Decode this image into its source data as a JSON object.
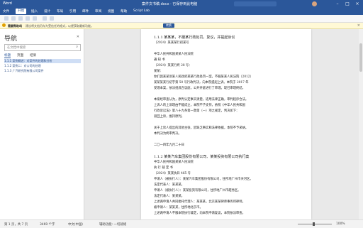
{
  "window": {
    "app_name": "Word",
    "title": "案件文书稿.docx · 已保存到此电脑",
    "minimize": "–",
    "maximize": "□",
    "close": "×"
  },
  "menu": [
    "文件",
    "开始",
    "插入",
    "设计",
    "布局",
    "引用",
    "邮件",
    "审阅",
    "视图",
    "帮助",
    "Script Lab"
  ],
  "menu_active_index": 1,
  "notice": {
    "label": "需要帮助吗",
    "message": "建议将文档另存为受信任的格式，以便获取最新功能。",
    "button": "转换",
    "close": "×"
  },
  "nav": {
    "title": "导航",
    "search_placeholder": "在文档中搜索",
    "tabs": [
      "标题",
      "页面",
      "结果"
    ],
    "items": [
      "1.1.1 案例概述：对案件的处理和分析",
      "1.1.2 案例二：对公司的处理",
      "1.1.3 广汽研究院有限公司案件"
    ],
    "selected_index": 0
  },
  "document": {
    "lines": [
      "1.1.1 某某某，不服某行政处罚，复议，并提起诉讼",
      "（2024）某某某行初某号",
      "",
      "中华人民共和国某某人民法院",
      "通  知  书",
      "（2024）某某行终 28 号：",
      "某某：",
      "你们因某某诉某人民政府某某行政处罚一案，不服某某人民法院（2012）",
      "某某某某行初字第 50 号行政判决，向本院提起上诉。本院于 2017 年",
      "受理本案，依法组成合议庭，公开开庭进行了审理。现已审理终结。",
      "",
      "本案经审查认为，原判认定事实清楚，适用法律正确，审判程序合法。",
      "上诉人的上诉理由不能成立，本院不予支持。依照《中华人民共和国",
      "行政诉讼法》第八十九条第一款第（一）项之规定，判决如下：",
      "驳回上诉，维持原判。",
      "",
      "关于上诉人提出的其他主张，因缺乏事实和法律依据，本院不予采纳。",
      "本判决为终审判决。",
      "",
      "二〇一四年九月二十日",
      "",
      "1.1.2 某某汽车集团股份有限公司、某某投资有限公司执行案",
      "中华人民共和国某某人民法院",
      "执 行 裁 定 书",
      "（2024）某某执异 465 号",
      "申请人（被执行人）：某某汽车集团股份有限公司，住所地广州市天河区。",
      "法定代表人：某某某。",
      "申请人（被执行人）：某某投资有限公司，住所地广州市越秀区。",
      "法定代表人：某某某。",
      "上述两申请人共同委托代理人：某某某，北京某某律师事务所律师。",
      "被申请人：某某某，住所地北京市。",
      "上述两申请人不服本院执行裁定，向本院申请复议，本院依法审查。"
    ]
  },
  "status": {
    "page": "第 1 页，共 7 页",
    "words": "3469 个字",
    "language": "中文(中国)",
    "accessibility": "辅助功能: 一切就绪",
    "zoom": "100%"
  }
}
